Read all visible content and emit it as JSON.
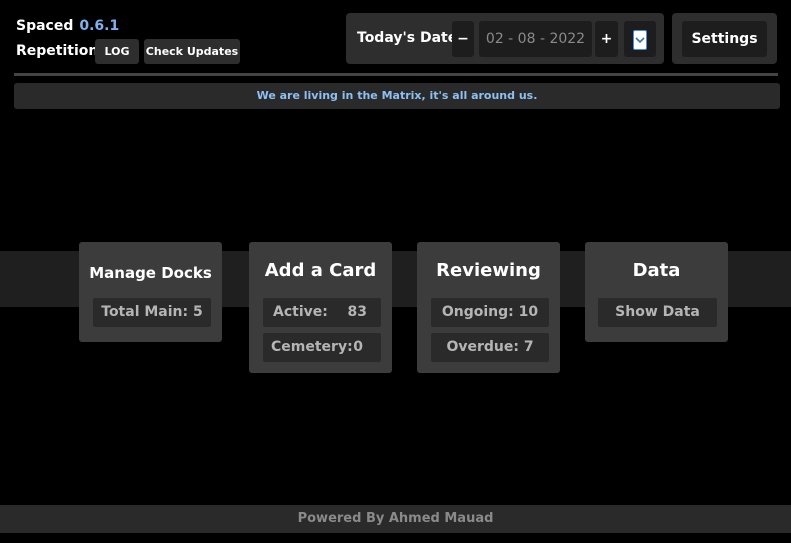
{
  "app": {
    "name_line1": "Spaced",
    "version": "0.6.1",
    "name_line2": "Repetition",
    "log_label": "LOG",
    "check_updates_label": "Check Updates"
  },
  "date": {
    "label": "Today's Date",
    "minus": "−",
    "value": "02 - 08 - 2022",
    "plus": "+"
  },
  "settings": {
    "label": "Settings"
  },
  "banner": {
    "text": "We are living in the Matrix, it's all around us."
  },
  "cards": {
    "manage": {
      "title": "Manage Docks",
      "total": "Total Main: 5"
    },
    "add": {
      "title": "Add a Card",
      "active_label": "Active:",
      "active_value": "83",
      "cemetery_label": "Cemetery:",
      "cemetery_value": "0"
    },
    "reviewing": {
      "title": "Reviewing",
      "ongoing": "Ongoing: 10",
      "overdue": "Overdue: 7"
    },
    "data": {
      "title": "Data",
      "show": "Show Data"
    }
  },
  "footer": {
    "text": "Powered By Ahmed Mauad"
  }
}
